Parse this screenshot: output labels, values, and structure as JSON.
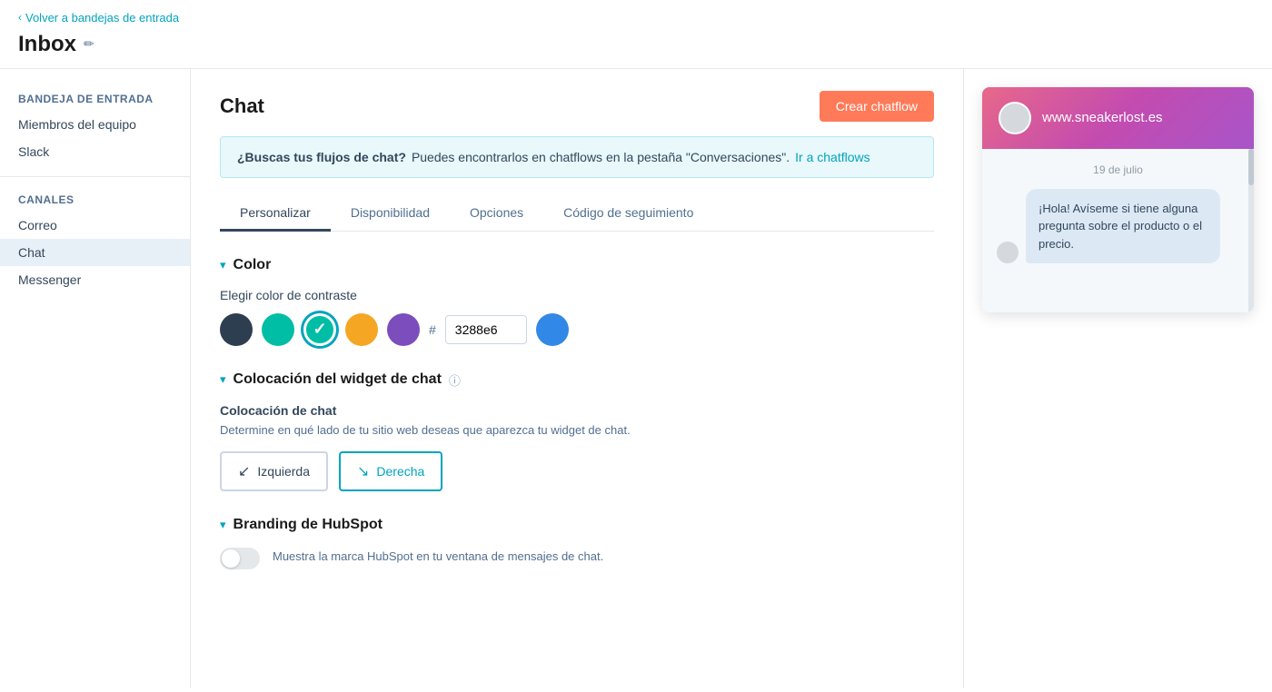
{
  "nav": {
    "back_label": "Volver a bandejas de entrada",
    "page_title": "Inbox"
  },
  "sidebar": {
    "section1_label": "Bandeja de entrada",
    "items_top": [
      {
        "id": "team-members",
        "label": "Miembros del equipo"
      },
      {
        "id": "slack",
        "label": "Slack"
      }
    ],
    "section2_label": "Canales",
    "items_channels": [
      {
        "id": "correo",
        "label": "Correo",
        "active": false
      },
      {
        "id": "chat",
        "label": "Chat",
        "active": true
      },
      {
        "id": "messenger",
        "label": "Messenger",
        "active": false
      }
    ]
  },
  "content": {
    "title": "Chat",
    "create_btn": "Crear chatflow",
    "banner": {
      "question": "¿Buscas tus flujos de chat?",
      "description": " Puedes encontrarlos en chatflows en la pestaña \"Conversaciones\".",
      "link_text": "Ir a chatflows"
    },
    "tabs": [
      {
        "id": "personalizar",
        "label": "Personalizar",
        "active": true
      },
      {
        "id": "disponibilidad",
        "label": "Disponibilidad",
        "active": false
      },
      {
        "id": "opciones",
        "label": "Opciones",
        "active": false
      },
      {
        "id": "codigo",
        "label": "Código de seguimiento",
        "active": false
      }
    ],
    "color_section": {
      "title": "Color",
      "subtitle": "Elegir color de contraste",
      "swatches": [
        {
          "id": "dark",
          "color": "#2d3e50",
          "selected": false
        },
        {
          "id": "teal",
          "color": "#00bda5",
          "selected": false
        },
        {
          "id": "teal-check",
          "color": "#00bda5",
          "selected": true,
          "check": true
        },
        {
          "id": "orange",
          "color": "#f5a623",
          "selected": false
        },
        {
          "id": "purple",
          "color": "#7c4dbd",
          "selected": false
        }
      ],
      "hex_value": "3288e6",
      "preview_color": "#3288e6"
    },
    "widget_section": {
      "title": "Colocación del widget de chat",
      "sub_title": "Colocación de chat",
      "description": "Determine en qué lado de tu sitio web deseas que aparezca tu widget de chat.",
      "options": [
        {
          "id": "izquierda",
          "label": "Izquierda",
          "active": false
        },
        {
          "id": "derecha",
          "label": "Derecha",
          "active": true
        }
      ]
    },
    "branding_section": {
      "title": "Branding de HubSpot",
      "description": "Muestra la marca HubSpot en tu ventana de mensajes de chat."
    }
  },
  "preview": {
    "domain": "www.sneakerlost.es",
    "date": "19 de julio",
    "message": "¡Hola! Avíseme si tiene alguna pregunta sobre el producto o el precio."
  }
}
